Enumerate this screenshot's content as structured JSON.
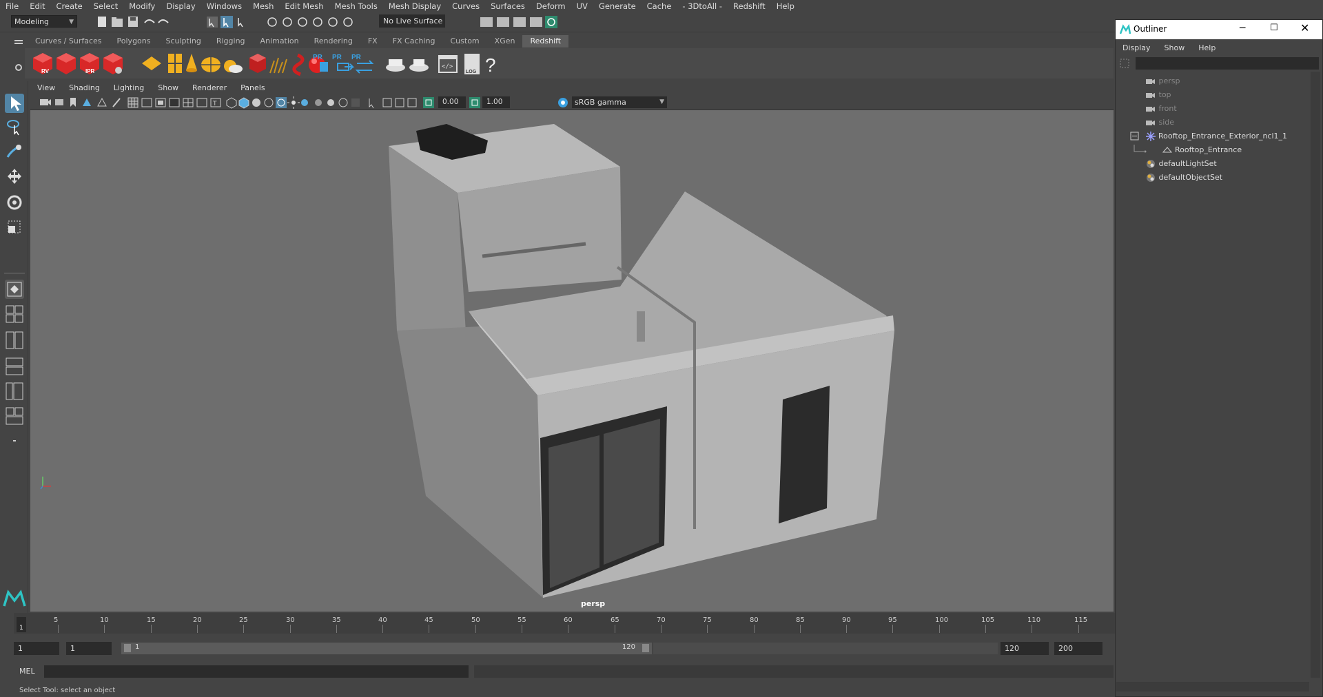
{
  "menubar": {
    "items": [
      "File",
      "Edit",
      "Create",
      "Select",
      "Modify",
      "Display",
      "Windows",
      "Mesh",
      "Edit Mesh",
      "Mesh Tools",
      "Mesh Display",
      "Curves",
      "Surfaces",
      "Deform",
      "UV",
      "Generate",
      "Cache",
      "- 3DtoAll -",
      "Redshift",
      "Help"
    ]
  },
  "statusline": {
    "mode": "Modeling",
    "live_surface": "No Live Surface"
  },
  "shelf": {
    "tabs": [
      "Curves / Surfaces",
      "Polygons",
      "Sculpting",
      "Rigging",
      "Animation",
      "Rendering",
      "FX",
      "FX Caching",
      "Custom",
      "XGen",
      "Redshift"
    ],
    "active_tab": "Redshift",
    "icon_labels": {
      "rv": "RV",
      "ipr": "IPR",
      "pr1": "PR",
      "pr2": "PR",
      "pr3": "PR",
      "log": "LOG",
      "help": "?"
    }
  },
  "panel": {
    "menus": [
      "View",
      "Shading",
      "Lighting",
      "Show",
      "Renderer",
      "Panels"
    ],
    "exposure": "0.00",
    "gamma": "1.00",
    "color_space": "sRGB gamma",
    "camera_label": "persp"
  },
  "timeline": {
    "ticks": [
      "5",
      "10",
      "15",
      "20",
      "25",
      "30",
      "35",
      "40",
      "45",
      "50",
      "55",
      "60",
      "65",
      "70",
      "75",
      "80",
      "85",
      "90",
      "95",
      "100",
      "105",
      "110",
      "115"
    ],
    "current_frame_marker": "1",
    "start_frame": "1",
    "playback_start": "1",
    "range_start_label": "1",
    "range_end_label": "120",
    "playback_end": "120",
    "end_frame": "200"
  },
  "command": {
    "language": "MEL"
  },
  "helpline": {
    "text": "Select Tool: select an object"
  },
  "outliner": {
    "title": "Outliner",
    "menus": [
      "Display",
      "Show",
      "Help"
    ],
    "items": [
      {
        "label": "persp",
        "type": "camera",
        "dim": true
      },
      {
        "label": "top",
        "type": "camera",
        "dim": true
      },
      {
        "label": "front",
        "type": "camera",
        "dim": true
      },
      {
        "label": "side",
        "type": "camera",
        "dim": true
      },
      {
        "label": "Rooftop_Entrance_Exterior_ncl1_1",
        "type": "group",
        "expanded": true
      },
      {
        "label": "Rooftop_Entrance",
        "type": "mesh",
        "child": true
      },
      {
        "label": "defaultLightSet",
        "type": "set"
      },
      {
        "label": "defaultObjectSet",
        "type": "set"
      }
    ]
  },
  "colors": {
    "accent": "#5285a6",
    "viewport_bg": "#6e6e6e",
    "ui_bg": "#444444"
  }
}
